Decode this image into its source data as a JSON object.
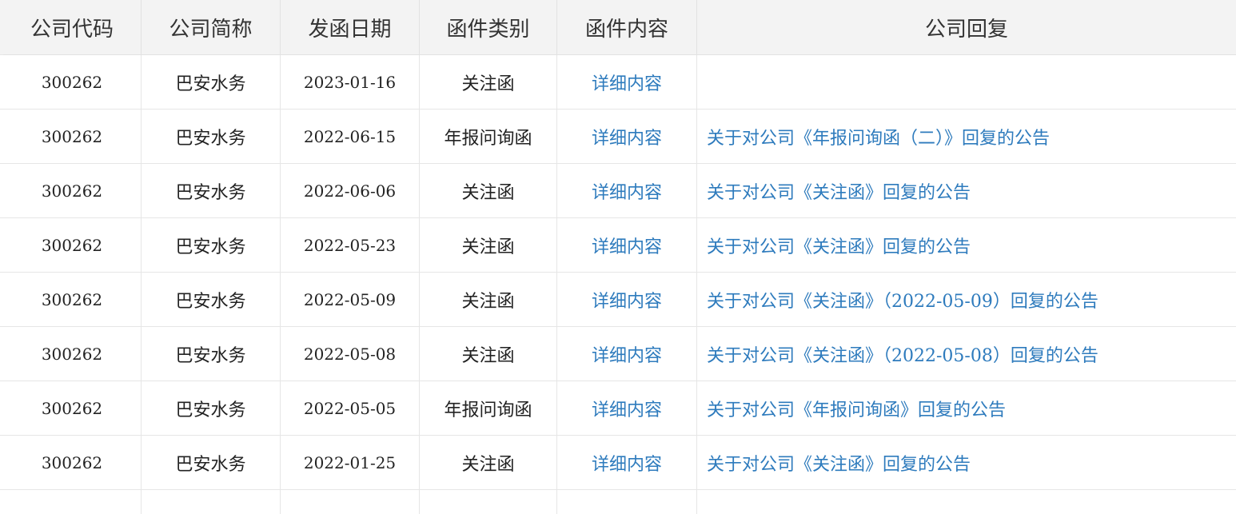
{
  "table": {
    "headers": [
      "公司代码",
      "公司简称",
      "发函日期",
      "函件类别",
      "函件内容",
      "公司回复"
    ],
    "rows": [
      {
        "code": "300262",
        "name": "巴安水务",
        "date": "2023-01-16",
        "category": "关注函",
        "content": "详细内容",
        "reply": ""
      },
      {
        "code": "300262",
        "name": "巴安水务",
        "date": "2022-06-15",
        "category": "年报问询函",
        "content": "详细内容",
        "reply": "关于对公司《年报问询函（二）》回复的公告"
      },
      {
        "code": "300262",
        "name": "巴安水务",
        "date": "2022-06-06",
        "category": "关注函",
        "content": "详细内容",
        "reply": "关于对公司《关注函》回复的公告"
      },
      {
        "code": "300262",
        "name": "巴安水务",
        "date": "2022-05-23",
        "category": "关注函",
        "content": "详细内容",
        "reply": "关于对公司《关注函》回复的公告"
      },
      {
        "code": "300262",
        "name": "巴安水务",
        "date": "2022-05-09",
        "category": "关注函",
        "content": "详细内容",
        "reply": "关于对公司《关注函》（2022-05-09）回复的公告"
      },
      {
        "code": "300262",
        "name": "巴安水务",
        "date": "2022-05-08",
        "category": "关注函",
        "content": "详细内容",
        "reply": "关于对公司《关注函》（2022-05-08）回复的公告"
      },
      {
        "code": "300262",
        "name": "巴安水务",
        "date": "2022-05-05",
        "category": "年报问询函",
        "content": "详细内容",
        "reply": "关于对公司《年报问询函》回复的公告"
      },
      {
        "code": "300262",
        "name": "巴安水务",
        "date": "2022-01-25",
        "category": "关注函",
        "content": "详细内容",
        "reply": "关于对公司《关注函》回复的公告"
      }
    ]
  },
  "colors": {
    "link": "#2e7bbd",
    "header_bg": "#f3f3f3",
    "border": "#e6e6e6"
  }
}
